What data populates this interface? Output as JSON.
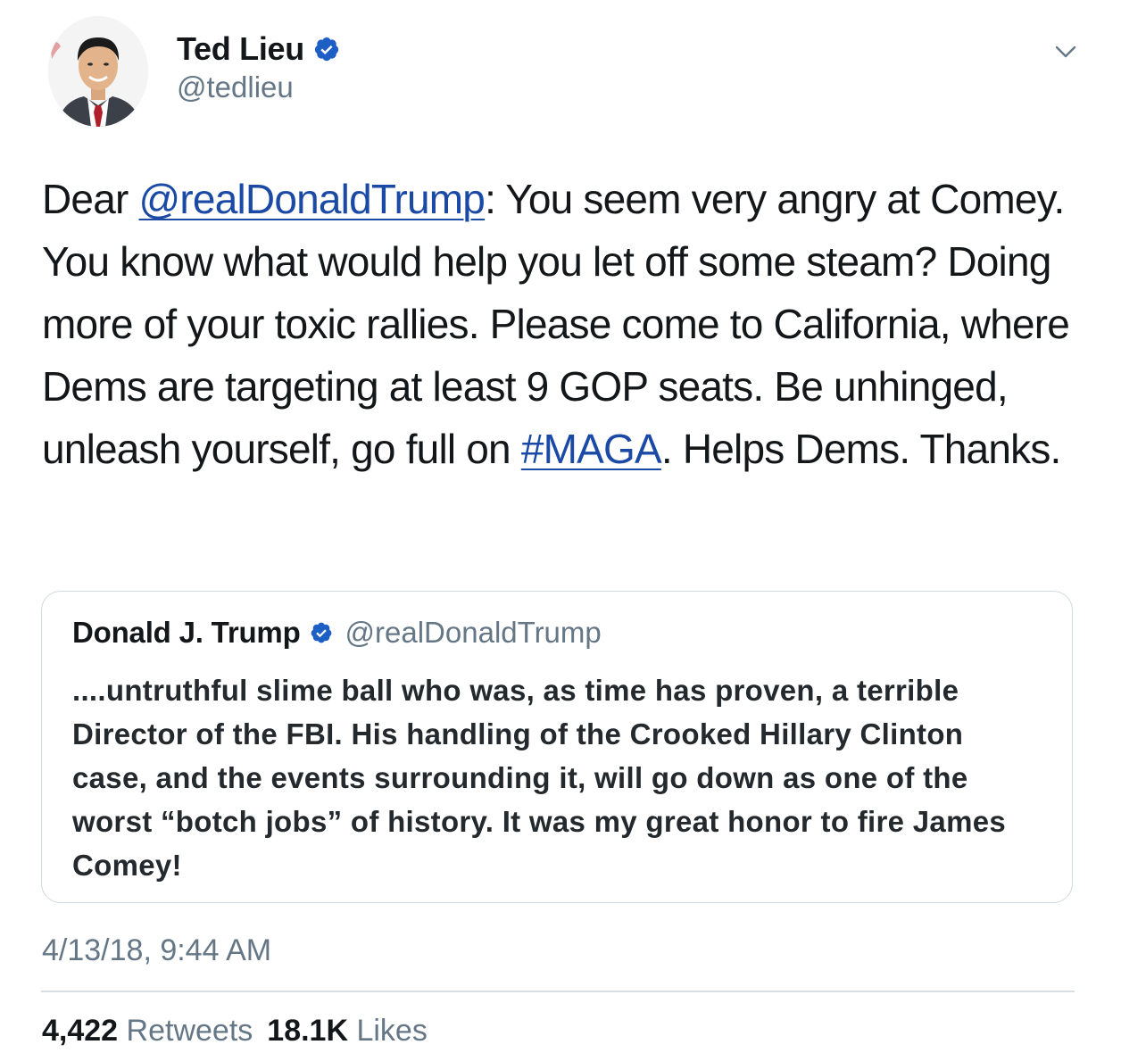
{
  "tweet": {
    "author": {
      "name": "Ted Lieu",
      "handle": "@tedlieu",
      "verified": true
    },
    "text_parts": {
      "p1": "Dear ",
      "mention": "@realDonaldTrump",
      "p2": ": You seem very angry at Comey. You know what would help you let off some steam? Doing more of your toxic rallies. Please come to California, where Dems are targeting at least 9 GOP seats. Be unhinged, unleash yourself, go full on ",
      "hashtag": "#MAGA",
      "p3": ". Helps Dems. Thanks."
    },
    "quoted": {
      "name": "Donald J. Trump",
      "handle": "@realDonaldTrump",
      "verified": true,
      "text": "....untruthful slime ball who was, as time has proven, a terrible Director of the FBI. His handling of the Crooked Hillary Clinton case, and the events surrounding it, will go down as one of the worst “botch jobs” of history. It was my great honor to fire James Comey!"
    },
    "timestamp": "4/13/18, 9:44 AM",
    "stats": {
      "retweets_count": "4,422",
      "retweets_label": "Retweets",
      "likes_count": "18.1K",
      "likes_label": "Likes"
    }
  },
  "icons": {
    "verified": "verified-badge-icon",
    "caret": "chevron-down-icon"
  },
  "colors": {
    "link": "#1b4aa6",
    "verified": "#1d5fc4",
    "secondary_text": "#657786",
    "border": "#cfd9de"
  }
}
